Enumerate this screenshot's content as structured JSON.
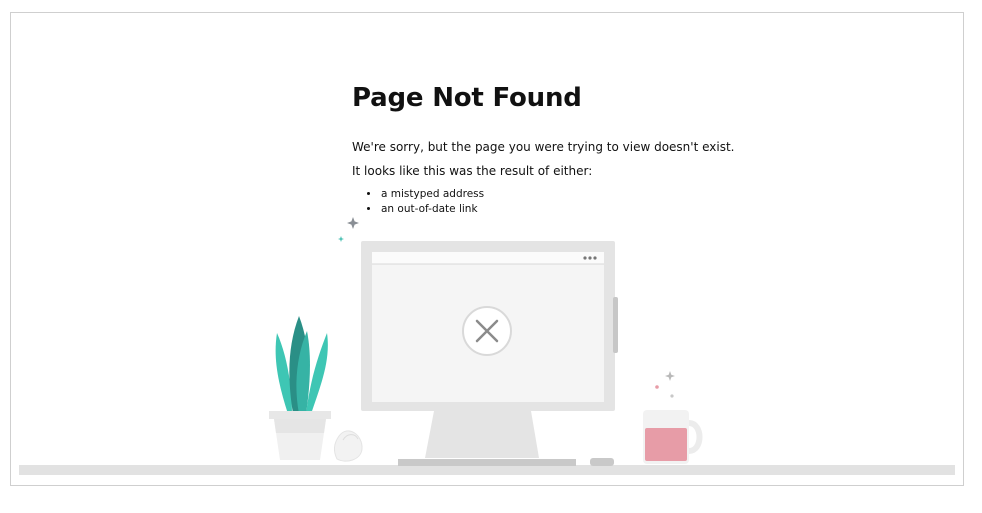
{
  "page": {
    "title": "Page Not Found",
    "message": "We're sorry, but the page you were trying to view doesn't exist.",
    "cause_intro": "It looks like this was the result of either:",
    "causes": [
      "a mistyped address",
      "an out-of-date link"
    ]
  },
  "illustration": {
    "icons": [
      "plant-icon",
      "monitor-icon",
      "close-icon",
      "mug-icon",
      "sparkle-icon"
    ],
    "colors": {
      "plant": "#3ec6b4",
      "plant_dark": "#2a8f86",
      "monitor": "#e6e6e6",
      "screen": "#f4f4f4",
      "mug": "#e79ca7",
      "desk": "#e2e2e2",
      "sparkle": "#9aa0a6"
    }
  }
}
